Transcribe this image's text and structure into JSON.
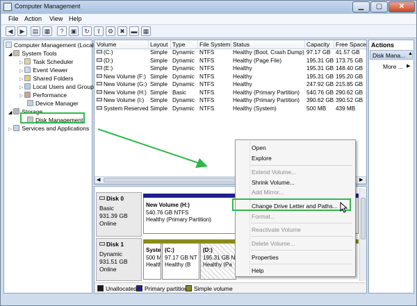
{
  "window": {
    "title": "Computer Management"
  },
  "menus": [
    "File",
    "Action",
    "View",
    "Help"
  ],
  "toolbar_icons": [
    "back-arrow-icon",
    "forward-arrow-icon",
    "folder-up-icon",
    "tree-view-icon",
    "help-icon",
    "properties-icon",
    "refresh-icon",
    "export-icon",
    "settings-icon",
    "delete-icon",
    "folder-icon",
    "grid-icon"
  ],
  "tree": {
    "root": "Computer Management (Local",
    "system_tools": "System Tools",
    "items": [
      "Task Scheduler",
      "Event Viewer",
      "Shared Folders",
      "Local Users and Groups",
      "Performance",
      "Device Manager"
    ],
    "storage": "Storage",
    "disk_management": "Disk Management",
    "services": "Services and Applications"
  },
  "volumes": {
    "headers": [
      "Volume",
      "Layout",
      "Type",
      "File System",
      "Status",
      "Capacity",
      "Free Space"
    ],
    "rows": [
      [
        "(C:)",
        "Simple",
        "Dynamic",
        "NTFS",
        "Healthy (Boot, Crash Dump)",
        "97.17 GB",
        "41.57 GB"
      ],
      [
        "(D:)",
        "Simple",
        "Dynamic",
        "NTFS",
        "Healthy (Page File)",
        "195.31 GB",
        "173.75 GB"
      ],
      [
        "(E:)",
        "Simple",
        "Dynamic",
        "NTFS",
        "Healthy",
        "195.31 GB",
        "148.40 GB"
      ],
      [
        "New Volume (F:)",
        "Simple",
        "Dynamic",
        "NTFS",
        "Healthy",
        "195.31 GB",
        "195.20 GB"
      ],
      [
        "New Volume (G:)",
        "Simple",
        "Dynamic",
        "NTFS",
        "Healthy",
        "247.92 GB",
        "215.85 GB"
      ],
      [
        "New Volume (H:)",
        "Simple",
        "Basic",
        "NTFS",
        "Healthy (Primary Partition)",
        "540.76 GB",
        "290.62 GB"
      ],
      [
        "New Volume (I:)",
        "Simple",
        "Dynamic",
        "NTFS",
        "Healthy (Primary Partition)",
        "390.62 GB",
        "390.52 GB"
      ],
      [
        "System Reserved",
        "Simple",
        "Dynamic",
        "NTFS",
        "Healthy (System)",
        "500 MB",
        "439 MB"
      ]
    ]
  },
  "disks": {
    "disk0": {
      "name": "Disk 0",
      "type": "Basic",
      "size": "931.39 GB",
      "state": "Online",
      "part_name": "New Volume  (H:)",
      "part_size": "540.76 GB NTFS",
      "part_status": "Healthy (Primary Partition)"
    },
    "disk1": {
      "name": "Disk 1",
      "type": "Dynamic",
      "size": "931.51 GB",
      "state": "Online",
      "p1_name": "Syste",
      "p1_size": "500 M",
      "p1_status": "Health",
      "p2_name": "(C:)",
      "p2_size": "97.17 GB NT",
      "p2_status": "Healthy (B",
      "p3_name": "(D:)",
      "p3_size": "195.31 GB NT",
      "p3_status": "Healthy (Pa"
    }
  },
  "legend": [
    "Unallocated",
    "Primary partition",
    "Simple volume"
  ],
  "colors": {
    "unallocated": "#1a1a1a",
    "primary": "#1f1f8f",
    "simple": "#8b8b1c",
    "highlight": "#2fb84a"
  },
  "actions": {
    "header": "Actions",
    "subheader": "Disk Mana...",
    "more": "More ..."
  },
  "context_menu": {
    "items": [
      {
        "label": "Open",
        "disabled": false
      },
      {
        "label": "Explore",
        "disabled": false
      },
      {
        "label": "Extend Volume...",
        "disabled": true
      },
      {
        "label": "Shrink Volume...",
        "disabled": false
      },
      {
        "label": "Add Mirror...",
        "disabled": true
      },
      {
        "label": "Change Drive Letter and Paths...",
        "disabled": false
      },
      {
        "label": "Format...",
        "disabled": true
      },
      {
        "label": "Reactivate Volume",
        "disabled": true
      },
      {
        "label": "Delete Volume...",
        "disabled": true
      },
      {
        "label": "Properties",
        "disabled": false
      },
      {
        "label": "Help",
        "disabled": false
      }
    ]
  }
}
